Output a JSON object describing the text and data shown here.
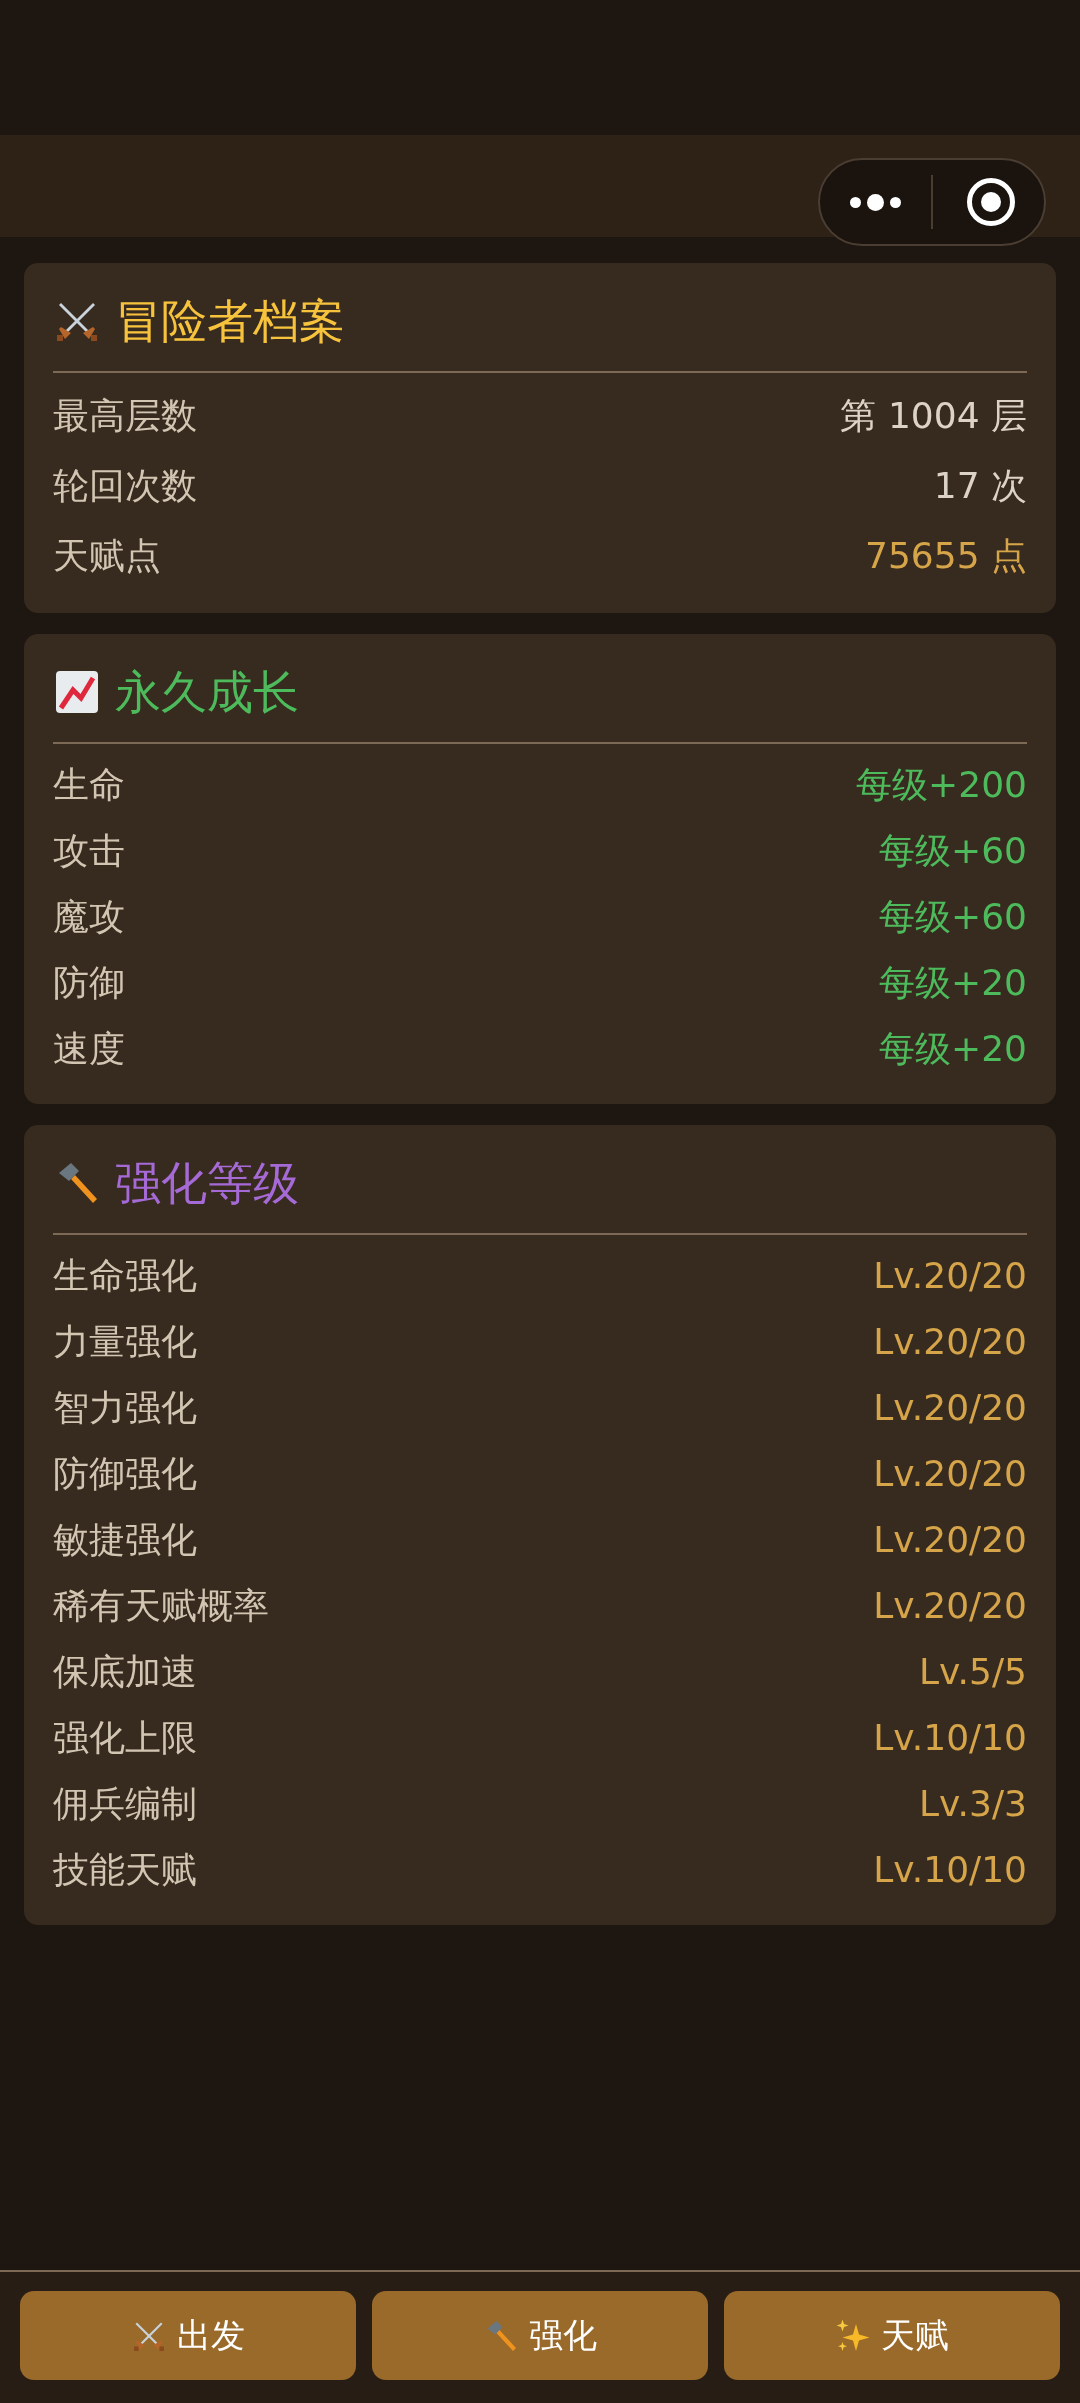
{
  "sections": [
    {
      "kind": "swords",
      "title": "冒险者档案",
      "color": "#f7c33d",
      "rows": [
        {
          "label": "最高层数",
          "value": "第 1004 层",
          "color": "#dcd3c6"
        },
        {
          "label": "轮回次数",
          "value": "17 次",
          "color": "#dcd3c6"
        },
        {
          "label": "天赋点",
          "value": "75655 点",
          "color": "#d6a54a"
        }
      ]
    },
    {
      "kind": "chart",
      "title": "永久成长",
      "color": "#4dbb5c",
      "rows": [
        {
          "label": "生命",
          "value": "每级+200",
          "color": "#4dbb5c"
        },
        {
          "label": "攻击",
          "value": "每级+60",
          "color": "#4dbb5c"
        },
        {
          "label": "魔攻",
          "value": "每级+60",
          "color": "#4dbb5c"
        },
        {
          "label": "防御",
          "value": "每级+20",
          "color": "#4dbb5c"
        },
        {
          "label": "速度",
          "value": "每级+20",
          "color": "#4dbb5c"
        }
      ]
    },
    {
      "kind": "hammer",
      "title": "强化等级",
      "color": "#a66ad6",
      "rows": [
        {
          "label": "生命强化",
          "value": "Lv.20/20",
          "color": "#d6a54a"
        },
        {
          "label": "力量强化",
          "value": "Lv.20/20",
          "color": "#d6a54a"
        },
        {
          "label": "智力强化",
          "value": "Lv.20/20",
          "color": "#d6a54a"
        },
        {
          "label": "防御强化",
          "value": "Lv.20/20",
          "color": "#d6a54a"
        },
        {
          "label": "敏捷强化",
          "value": "Lv.20/20",
          "color": "#d6a54a"
        },
        {
          "label": "稀有天赋概率",
          "value": "Lv.20/20",
          "color": "#d6a54a"
        },
        {
          "label": "保底加速",
          "value": "Lv.5/5",
          "color": "#d6a54a"
        },
        {
          "label": "强化上限",
          "value": "Lv.10/10",
          "color": "#d6a54a"
        },
        {
          "label": "佣兵编制",
          "value": "Lv.3/3",
          "color": "#d6a54a"
        },
        {
          "label": "技能天赋",
          "value": "Lv.10/10",
          "color": "#d6a54a"
        }
      ]
    }
  ],
  "buttons": [
    {
      "kind": "swords",
      "label": "出发"
    },
    {
      "kind": "hammer",
      "label": "强化"
    },
    {
      "kind": "sparkles",
      "label": "天赋"
    }
  ]
}
